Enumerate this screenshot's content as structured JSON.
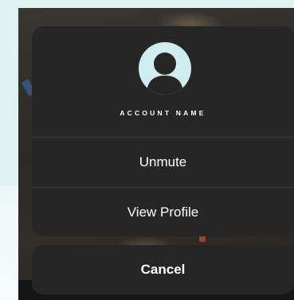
{
  "sheet": {
    "avatar_icon": "user-avatar-icon",
    "account_name": "ACCOUNT NAME",
    "options": [
      {
        "label": "Unmute"
      },
      {
        "label": "View Profile"
      }
    ],
    "cancel_label": "Cancel"
  },
  "colors": {
    "page_background": "#dff2f3",
    "sheet_background": "#262626",
    "avatar_background": "#d1ecee",
    "text": "#ffffff"
  }
}
